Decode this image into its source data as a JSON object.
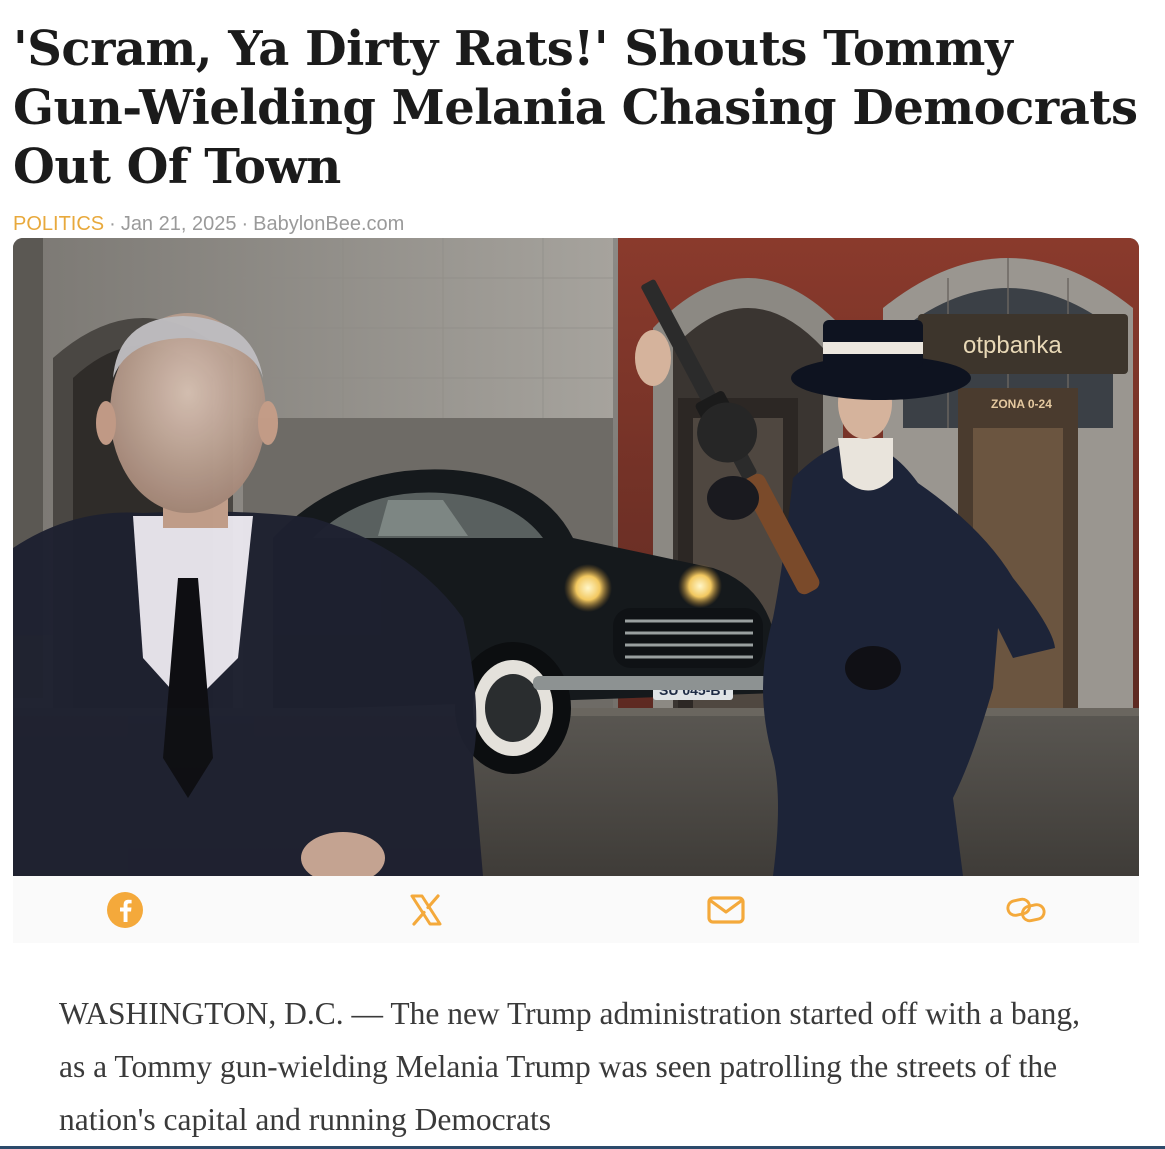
{
  "article": {
    "headline": "'Scram, Ya Dirty Rats!' Shouts Tommy Gun-Wielding Melania Chasing Democrats Out Of Town",
    "category": "POLITICS",
    "date": "Jan 21, 2025",
    "source": "BabylonBee.com",
    "separator": "·",
    "body_first_paragraph": "WASHINGTON, D.C. — The new Trump administration started off with a bang, as a Tommy gun-wielding Melania Trump was seen patrolling the streets of the nation's capital and running Democrats"
  },
  "hero_image": {
    "bank_sign": "otpbanka",
    "zone_sign": "ZONA 0-24",
    "license_plate": "SU 045-BT"
  },
  "share": {
    "icons": [
      "facebook-icon",
      "x-icon",
      "email-icon",
      "link-icon"
    ],
    "accent_color": "#f4a93b"
  },
  "colors": {
    "headline": "#1b1b1b",
    "category": "#e8a93c",
    "meta": "#9a9a9a",
    "body_text": "#3a3a3a"
  }
}
